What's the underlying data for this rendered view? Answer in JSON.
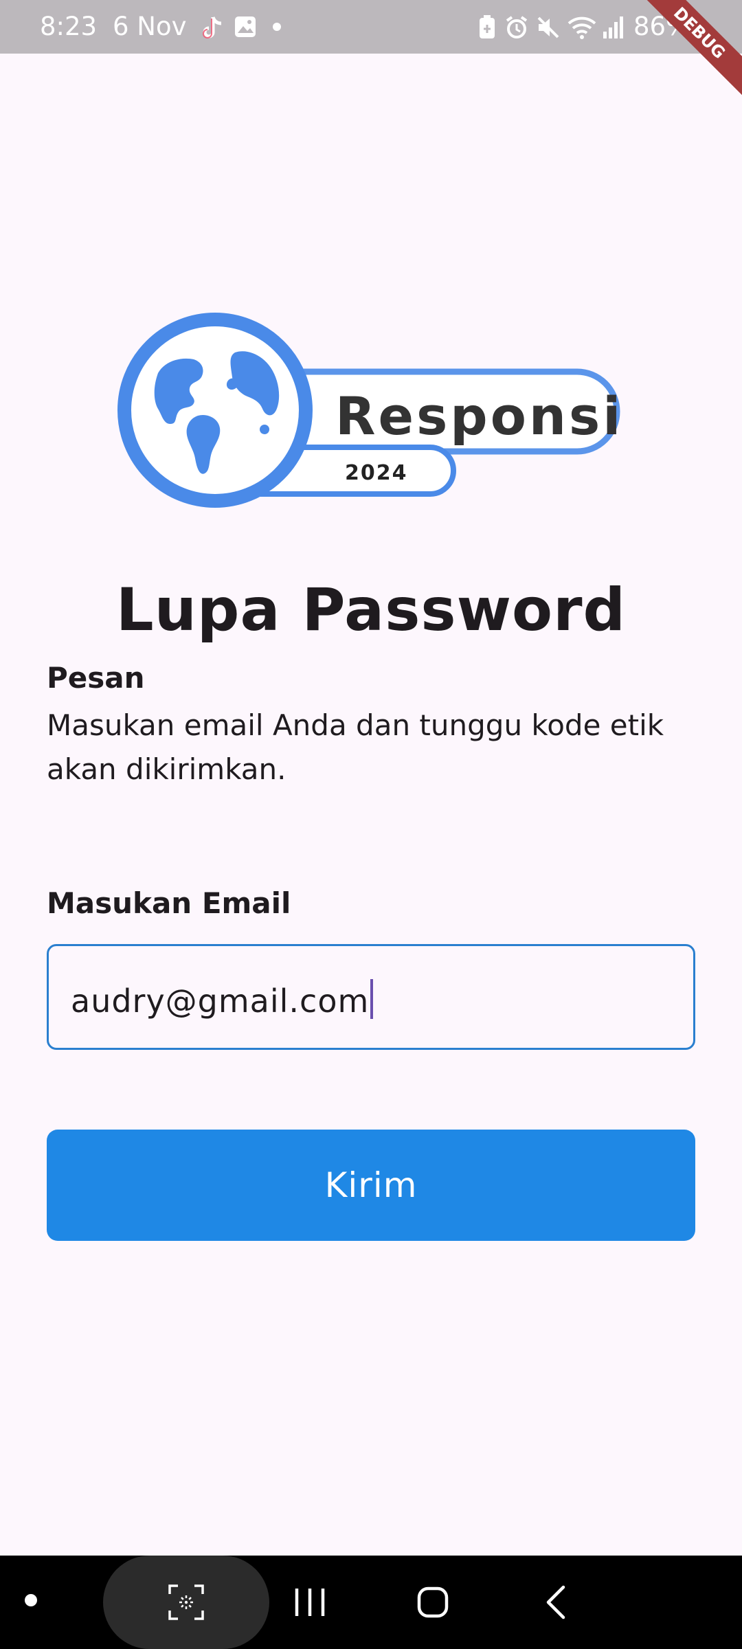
{
  "status_bar": {
    "time": "8:23",
    "date": "6 Nov",
    "battery": "86%",
    "debug_label": "DEBUG"
  },
  "logo": {
    "brand_name": "Responsi",
    "year": "2024",
    "color": "#4a8ae8"
  },
  "page": {
    "title": "Lupa Password",
    "message_label": "Pesan",
    "message_text": "Masukan email Anda dan tunggu kode etik akan dikirimkan."
  },
  "form": {
    "email_label": "Masukan Email",
    "email_value": "audry@gmail.com",
    "submit_label": "Kirim"
  },
  "colors": {
    "accent": "#1f88e5",
    "field_border": "#2a7fcf",
    "background": "#fdf7fd"
  },
  "nav_bar": {
    "icons": [
      "screenshot-icon",
      "recent-apps-icon",
      "home-icon",
      "back-icon"
    ]
  }
}
